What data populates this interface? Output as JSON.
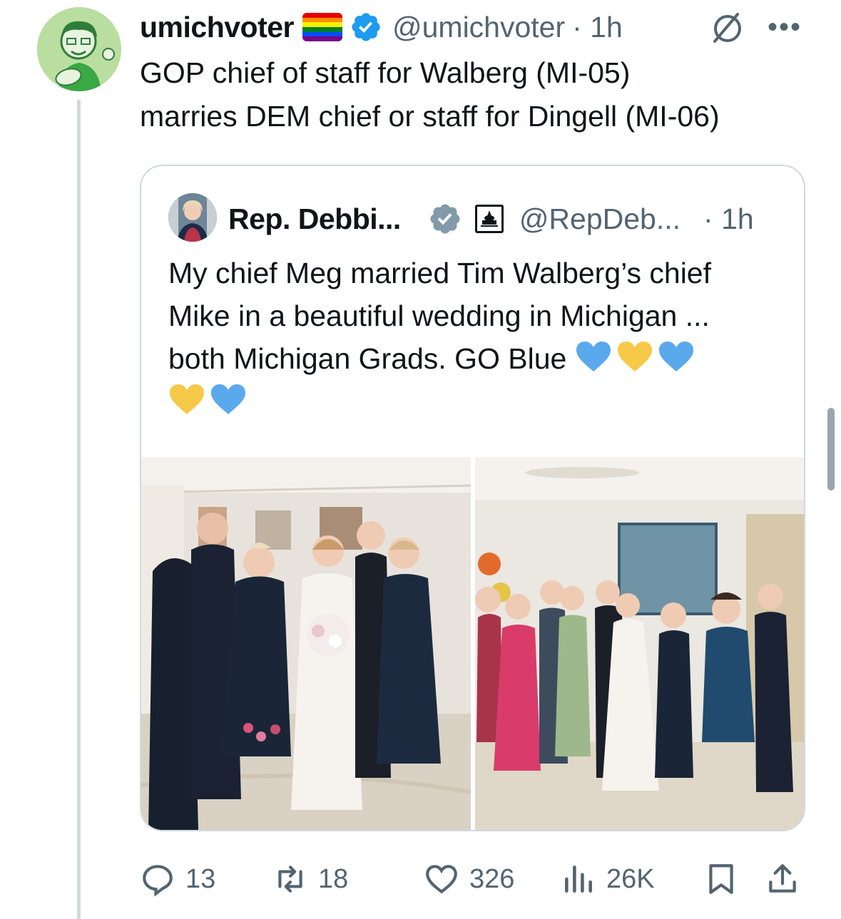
{
  "post": {
    "display_name": "umichvoter",
    "handle": "@umichvoter",
    "time": "· 1h",
    "more": "•••",
    "text_line1": "GOP chief of staff for Walberg (MI-05)",
    "text_line2": "marries DEM chief or staff for Dingell (MI-06)"
  },
  "quote": {
    "display_name": "Rep. Debbi...",
    "handle": "@RepDeb...",
    "time": "· 1h",
    "text_line1": "My chief Meg married Tim Walberg’s chief",
    "text_line2": "Mike in a beautiful wedding in Michigan ...",
    "text_line3": "both Michigan Grads. GO Blue"
  },
  "actions": {
    "replies": "13",
    "reposts": "18",
    "likes": "326",
    "views": "26K"
  },
  "colors": {
    "verified_blue": "#1d9bf0",
    "gov_grey": "#829aab",
    "muted": "#536471",
    "heart_blue": "#5aa9ec",
    "heart_yellow": "#f7c948"
  },
  "icons": [
    "verified-badge-icon",
    "rainbow-flag-icon",
    "noise-icon",
    "more-icon",
    "government-badge-icon",
    "reply-icon",
    "repost-icon",
    "like-icon",
    "views-icon",
    "bookmark-icon",
    "share-icon",
    "blue-heart-icon",
    "yellow-heart-icon"
  ]
}
